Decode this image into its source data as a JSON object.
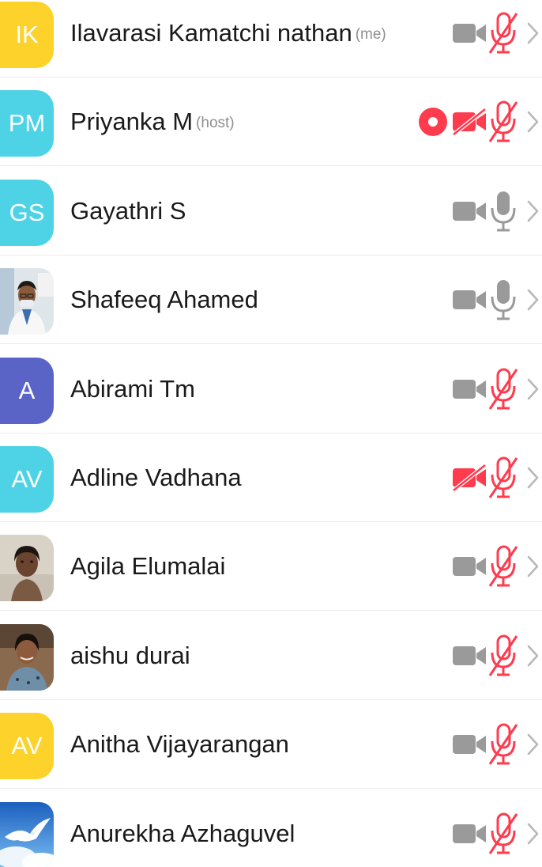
{
  "participants": [
    {
      "initials": "IK",
      "name": "Ilavarasi Kamatchi nathan",
      "role": "(me)",
      "avatar_color": "#fcd22b",
      "avatar": "initials",
      "video": "off-gray",
      "mic": "muted",
      "recording": false
    },
    {
      "initials": "PM",
      "name": "Priyanka M",
      "role": "(host)",
      "avatar_color": "#4dd2e6",
      "avatar": "initials",
      "video": "stopped",
      "mic": "muted",
      "recording": true
    },
    {
      "initials": "GS",
      "name": "Gayathri S",
      "role": "",
      "avatar_color": "#4dd2e6",
      "avatar": "initials",
      "video": "off-gray",
      "mic": "unmuted",
      "recording": false
    },
    {
      "initials": "",
      "name": "Shafeeq Ahamed",
      "role": "",
      "avatar_color": "#dfe6ea",
      "avatar": "photo-man",
      "video": "off-gray",
      "mic": "unmuted",
      "recording": false
    },
    {
      "initials": "A",
      "name": "Abirami Tm",
      "role": "",
      "avatar_color": "#5a63c6",
      "avatar": "initials",
      "video": "off-gray",
      "mic": "muted",
      "recording": false
    },
    {
      "initials": "AV",
      "name": "Adline Vadhana",
      "role": "",
      "avatar_color": "#4dd2e6",
      "avatar": "initials",
      "video": "stopped",
      "mic": "muted",
      "recording": false
    },
    {
      "initials": "",
      "name": "Agila Elumalai",
      "role": "",
      "avatar_color": "#d9d2c6",
      "avatar": "photo-woman",
      "video": "off-gray",
      "mic": "muted",
      "recording": false
    },
    {
      "initials": "",
      "name": "aishu durai",
      "role": "",
      "avatar_color": "#8a6a4e",
      "avatar": "photo-woman-dark",
      "video": "off-gray",
      "mic": "muted",
      "recording": false
    },
    {
      "initials": "AV",
      "name": "Anitha Vijayarangan",
      "role": "",
      "avatar_color": "#fcd22b",
      "avatar": "initials",
      "video": "off-gray",
      "mic": "muted",
      "recording": false
    },
    {
      "initials": "",
      "name": "Anurekha Azhaguvel",
      "role": "",
      "avatar_color": "#2f7fd8",
      "avatar": "photo-sky-bird",
      "video": "off-gray",
      "mic": "muted",
      "recording": false
    }
  ],
  "colors": {
    "icon_gray": "#9a9a9a",
    "icon_red": "#ff3b4e",
    "chevron": "#b8b8b8",
    "divider": "#ececec"
  },
  "icons": {
    "video": "video-camera-icon",
    "mic": "microphone-icon",
    "recording": "recording-indicator-icon",
    "more": "chevron-right-icon"
  }
}
